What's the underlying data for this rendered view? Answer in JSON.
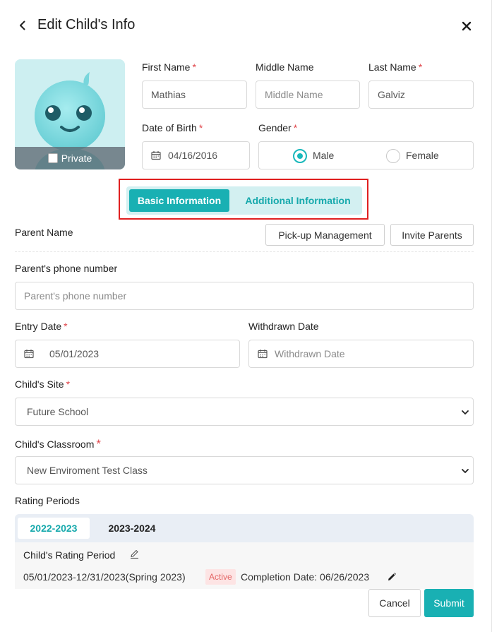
{
  "header": {
    "title": "Edit Child's Info"
  },
  "avatar": {
    "private_label": "Private",
    "private_checked": false
  },
  "fields": {
    "first_name": {
      "label": "First Name",
      "required": "*",
      "value": "Mathias"
    },
    "middle_name": {
      "label": "Middle Name",
      "placeholder": "Middle Name"
    },
    "last_name": {
      "label": "Last Name",
      "required": "*",
      "value": "Galviz"
    },
    "dob": {
      "label": "Date of Birth",
      "required": "*",
      "value": "04/16/2016"
    },
    "gender": {
      "label": "Gender",
      "required": "*",
      "options": [
        "Male",
        "Female"
      ],
      "selected": "Male"
    }
  },
  "tabs": {
    "basic": "Basic Information",
    "additional": "Additional Information"
  },
  "parent": {
    "label": "Parent Name",
    "pickup_button": "Pick-up Management",
    "invite_button": "Invite Parents"
  },
  "phone": {
    "label": "Parent's phone number",
    "placeholder": "Parent's phone number"
  },
  "entry_date": {
    "label": "Entry Date",
    "required": "*",
    "value": "05/01/2023"
  },
  "withdrawn_date": {
    "label": "Withdrawn Date",
    "placeholder": "Withdrawn Date"
  },
  "site": {
    "label": "Child's Site",
    "required": "*",
    "value": "Future School"
  },
  "classroom": {
    "label": "Child's Classroom",
    "required": "*",
    "value": "New Enviroment Test Class"
  },
  "rating": {
    "label": "Rating Periods",
    "tabs": [
      "2022-2023",
      "2023-2024"
    ],
    "active_tab": "2022-2023",
    "period_title": "Child's Rating Period",
    "period_range": "05/01/2023-12/31/2023(Spring 2023)",
    "status": "Active",
    "completion": "Completion Date: 06/26/2023"
  },
  "footer": {
    "cancel": "Cancel",
    "submit": "Submit"
  },
  "colors": {
    "accent": "#19b0b3",
    "required": "#e0464b",
    "highlight": "#e02020",
    "active_badge_bg": "#fde4e4"
  }
}
